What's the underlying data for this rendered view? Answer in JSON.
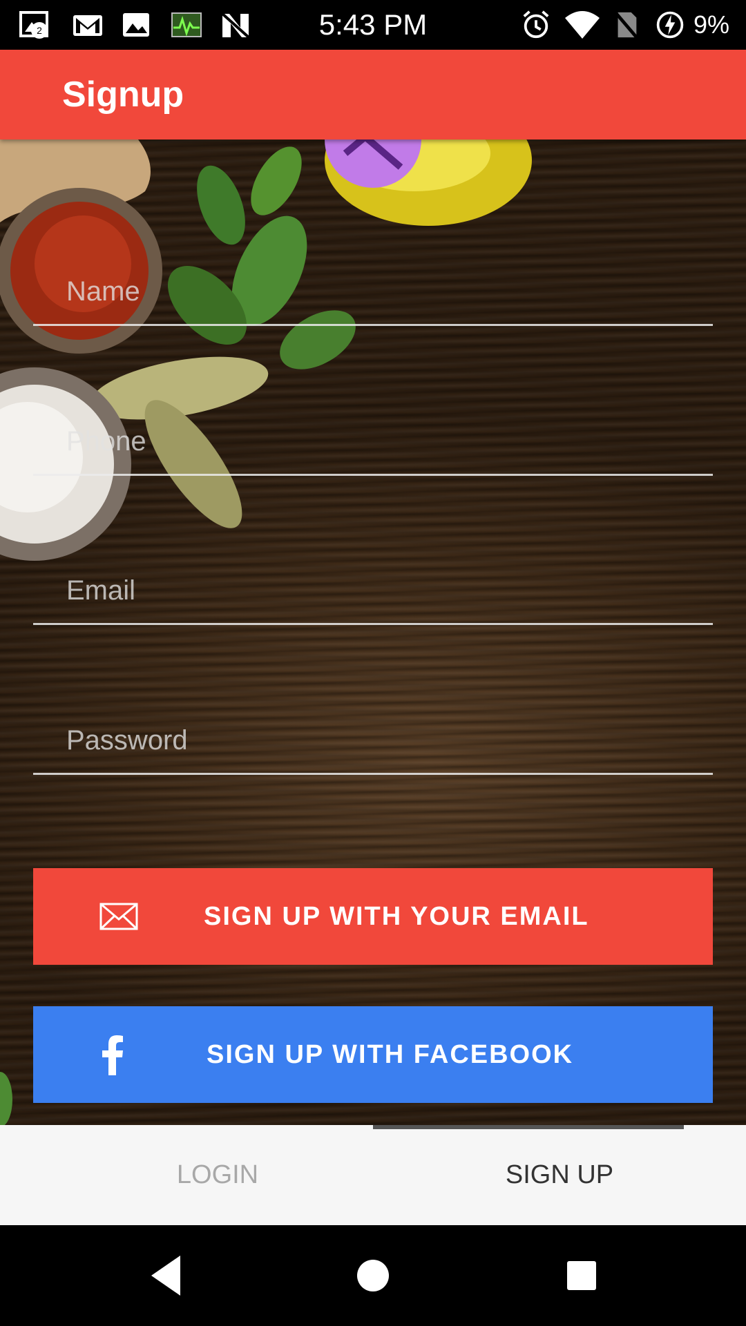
{
  "status_bar": {
    "time": "5:43 PM",
    "battery": "9%",
    "notification_badge": "2",
    "icons": [
      "gallery-badge-icon",
      "gmail-icon",
      "image-icon",
      "activity-monitor-icon",
      "n-app-icon",
      "alarm-icon",
      "wifi-icon",
      "no-sim-icon",
      "battery-charging-icon"
    ]
  },
  "app_bar": {
    "title": "Signup"
  },
  "form": {
    "name_placeholder": "Name",
    "phone_placeholder": "Phone",
    "email_placeholder": "Email",
    "password_placeholder": "Password"
  },
  "buttons": {
    "email_label": "SIGN UP WITH YOUR EMAIL",
    "email_icon": "envelope-icon",
    "facebook_label": "SIGN UP WITH FACEBOOK",
    "facebook_icon": "facebook-icon"
  },
  "tabs": [
    {
      "label": "LOGIN",
      "selected": false
    },
    {
      "label": "SIGN UP",
      "selected": true
    }
  ],
  "nav_bar": {
    "icons": [
      "back-icon",
      "home-icon",
      "recents-icon"
    ]
  },
  "colors": {
    "primary": "#f1483b",
    "facebook": "#3b7ff0",
    "tab_background": "#f6f6f6",
    "tab_inactive": "#a8a8a8",
    "tab_active": "#333333"
  }
}
